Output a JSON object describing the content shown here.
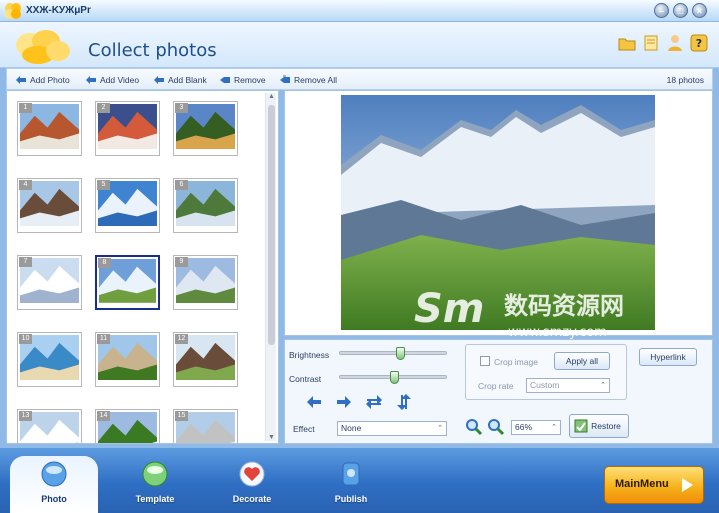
{
  "window": {
    "title": "XXЖ-KУЖμPr"
  },
  "header": {
    "title": "Collect photos",
    "icons": [
      "folder-icon",
      "note-icon",
      "user-icon",
      "help-icon"
    ]
  },
  "toolbar": {
    "add_photo": "Add Photo",
    "add_video": "Add Video",
    "add_blank": "Add Blank",
    "remove": "Remove",
    "remove_all": "Remove All",
    "photo_count": "18 photos"
  },
  "thumbnails": [
    {
      "num": "1"
    },
    {
      "num": "2"
    },
    {
      "num": "3"
    },
    {
      "num": "4"
    },
    {
      "num": "5"
    },
    {
      "num": "6"
    },
    {
      "num": "7"
    },
    {
      "num": "8",
      "selected": true
    },
    {
      "num": "9"
    },
    {
      "num": "10"
    },
    {
      "num": "11"
    },
    {
      "num": "12"
    },
    {
      "num": "13"
    },
    {
      "num": "14"
    },
    {
      "num": "15"
    }
  ],
  "edit": {
    "brightness_label": "Brightness",
    "contrast_label": "Contrast",
    "effect_label": "Effect",
    "effect_value": "None",
    "crop_image_label": "Crop image",
    "apply_all": "Apply all",
    "crop_rate_label": "Crop rate",
    "crop_rate_value": "Custom",
    "hyperlink": "Hyperlink",
    "zoom_value": "66%",
    "restore": "Restore"
  },
  "tabs": {
    "photo": "Photo",
    "template": "Template",
    "decorate": "Decorate",
    "publish": "Publish"
  },
  "main_menu": "MainMenu",
  "watermark": {
    "text": "数码资源网",
    "url": "www.smzy.com"
  }
}
